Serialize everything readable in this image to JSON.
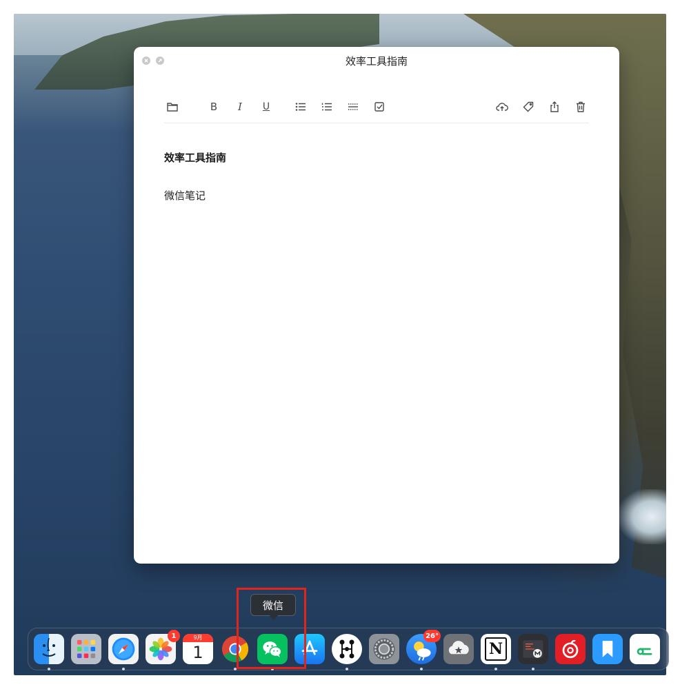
{
  "window": {
    "title": "效率工具指南",
    "controls": [
      "close-icon",
      "fullscreen-icon"
    ]
  },
  "toolbar": {
    "left_group": [
      "folder-icon",
      "bold-icon",
      "italic-icon",
      "underline-icon",
      "bullet-list-icon",
      "numbered-list-icon",
      "divider-line-icon",
      "checkbox-icon"
    ],
    "right_group": [
      "cloud-upload-icon",
      "tag-icon",
      "share-icon",
      "trash-icon"
    ],
    "bold_label": "B",
    "italic_label": "I",
    "underline_label": "U"
  },
  "document": {
    "heading": "效率工具指南",
    "body": "微信笔记"
  },
  "tooltip": {
    "text": "微信"
  },
  "dock": {
    "apps": [
      {
        "name": "Finder",
        "icon": "finder-icon",
        "running": true
      },
      {
        "name": "Launchpad",
        "icon": "launchpad-icon",
        "running": false
      },
      {
        "name": "Safari",
        "icon": "safari-icon",
        "running": true
      },
      {
        "name": "Photos",
        "icon": "photos-icon",
        "running": false,
        "badge": "1"
      },
      {
        "name": "Calendar",
        "icon": "calendar-icon",
        "running": false,
        "month": "9月",
        "day": "1"
      },
      {
        "name": "Chrome",
        "icon": "chrome-icon",
        "running": true
      },
      {
        "name": "WeChat",
        "icon": "wechat-icon",
        "running": true
      },
      {
        "name": "App Store",
        "icon": "app-store-icon",
        "running": false
      },
      {
        "name": "Mind map",
        "icon": "mindmap-icon",
        "running": true
      },
      {
        "name": "System Preferences",
        "icon": "system-preferences-icon",
        "running": false
      },
      {
        "name": "Weather",
        "icon": "weather-icon",
        "running": true,
        "badge": "26°"
      },
      {
        "name": "Cloud favorites",
        "icon": "cloud-star-icon",
        "running": false
      },
      {
        "name": "Notion",
        "icon": "notion-icon",
        "running": true,
        "letter": "N"
      },
      {
        "name": "Markdown editor",
        "icon": "markdown-editor-icon",
        "running": true
      },
      {
        "name": "NetEase Music",
        "icon": "netease-music-icon",
        "running": false
      },
      {
        "name": "Bookmarks",
        "icon": "bookmark-icon",
        "running": false
      },
      {
        "name": "Green app",
        "icon": "green-app-icon",
        "running": false
      }
    ]
  },
  "colors": {
    "highlight": "#e3241a",
    "badge": "#ff3b30",
    "wechat": "#07c160"
  }
}
